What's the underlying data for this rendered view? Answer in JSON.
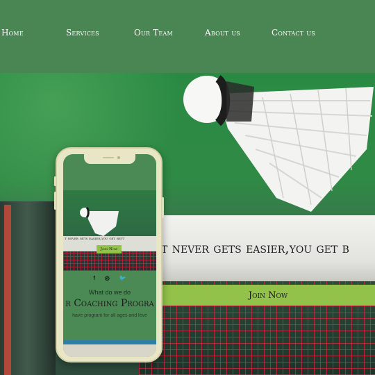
{
  "nav": {
    "items": [
      "Home",
      "Services",
      "Our Team",
      "About us",
      "Contact us"
    ]
  },
  "hero": {
    "headline": "t never gets easier,you get b",
    "join_label": "Join Now"
  },
  "phone": {
    "hero_text": "t never gets easier,you get bett",
    "join_label": "Join Now",
    "social": [
      "f",
      "◎",
      "🐦"
    ],
    "what_label": "What do we do",
    "coaching_title": "r Coaching Progra",
    "coaching_sub": "have program for all ages and leve"
  },
  "colors": {
    "nav_bg": "#4a8554",
    "accent": "#93c24a"
  }
}
